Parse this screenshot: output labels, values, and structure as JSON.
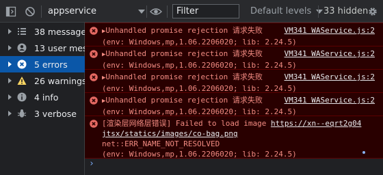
{
  "toolbar": {
    "context": "appservice",
    "filter_placeholder": "Filter",
    "levels": "Default levels",
    "hidden": "33 hidden"
  },
  "sidebar": {
    "items": [
      {
        "label": "38 messages",
        "icon": "list-icon"
      },
      {
        "label": "13 user mes...",
        "icon": "user-icon"
      },
      {
        "label": "5 errors",
        "icon": "error-icon",
        "active": true
      },
      {
        "label": "26 warnings",
        "icon": "warning-icon"
      },
      {
        "label": "4 info",
        "icon": "info-icon"
      },
      {
        "label": "3 verbose",
        "icon": "bug-icon"
      }
    ]
  },
  "console": {
    "messages": [
      {
        "arrow": "▶",
        "line1": "Unhandled promise rejection 请求失败",
        "source": "VM341 WAService.js:2",
        "line2": "(env: Windows,mp,1.06.2206020; lib: 2.24.5)"
      },
      {
        "arrow": "▶",
        "line1": "Unhandled promise rejection 请求失败",
        "source": "VM341 WAService.js:2",
        "line2": "(env: Windows,mp,1.06.2206020; lib: 2.24.5)"
      },
      {
        "arrow": "▶",
        "line1": "Unhandled promise rejection 请求失败",
        "source": "VM341 WAService.js:2",
        "line2": "(env: Windows,mp,1.06.2206020; lib: 2.24.5)"
      },
      {
        "arrow": "▶",
        "line1": "Unhandled promise rejection 请求失败",
        "source": "VM341 WAService.js:2",
        "line2": "(env: Windows,mp,1.06.2206020; lib: 2.24.5)"
      }
    ],
    "last": {
      "prefix": "[渲染层网络层错误] Failed to load image ",
      "url1": "https://xn--eqrt2g04",
      "url2": "jtsx/statics/images/co-bag.png",
      "line3": "net::ERR_NAME_NOT_RESOLVED",
      "line4": "(env: Windows,mp,1.06.2206020; lib: 2.24.5)"
    },
    "prompt": "›"
  },
  "colors": {
    "error_bg": "#290000",
    "error_text": "#f28b82",
    "active_item": "#0b57a8"
  }
}
